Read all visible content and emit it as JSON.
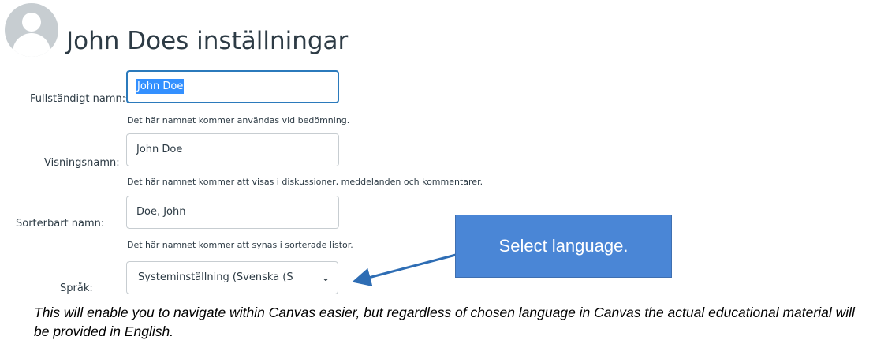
{
  "page": {
    "title": "John Does inställningar"
  },
  "form": {
    "full_name": {
      "label": "Fullständigt namn:*",
      "value": "John Doe",
      "hint": "Det här namnet kommer användas vid bedömning."
    },
    "display_name": {
      "label": "Visningsnamn:",
      "value": "John Doe",
      "hint": "Det här namnet kommer att visas i diskussioner, meddelanden och kommentarer."
    },
    "sortable_name": {
      "label": "Sorterbart namn:",
      "value": "Doe, John",
      "hint": "Det här namnet kommer att synas i sorterade listor."
    },
    "language": {
      "label": "Språk:",
      "selected": "Systeminställning (Svenska (S"
    }
  },
  "annotation": {
    "callout_text": "Select language.",
    "callout_color": "#4a86d6",
    "arrow_color": "#2e6db4",
    "note": "This will enable you to navigate within Canvas easier, but regardless of chosen language in Canvas the actual educational material will be provided in English."
  }
}
